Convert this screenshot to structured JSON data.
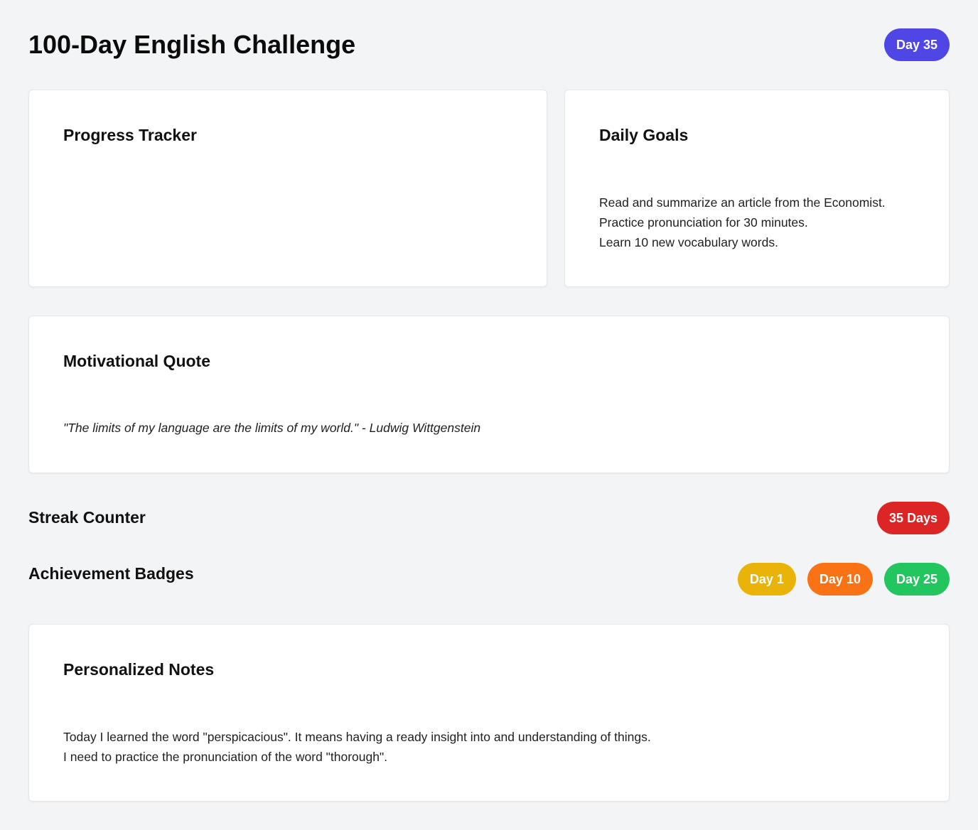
{
  "header": {
    "title": "100-Day English Challenge",
    "day_badge": "Day 35",
    "day_badge_color": "#4f46e5"
  },
  "progress": {
    "title": "Progress Tracker"
  },
  "goals": {
    "title": "Daily Goals",
    "items": [
      "Read and summarize an article from the Economist.",
      "Practice pronunciation for 30 minutes.",
      "Learn 10 new vocabulary words."
    ]
  },
  "quote": {
    "title": "Motivational Quote",
    "text": "\"The limits of my language are the limits of my world.\" - Ludwig Wittgenstein"
  },
  "streak": {
    "title": "Streak Counter",
    "value": "35 Days",
    "color": "#dc2626"
  },
  "badges": {
    "title": "Achievement Badges",
    "items": [
      {
        "label": "Day 1",
        "color": "#eab308"
      },
      {
        "label": "Day 10",
        "color": "#f97316"
      },
      {
        "label": "Day 25",
        "color": "#22c55e"
      }
    ]
  },
  "notes": {
    "title": "Personalized Notes",
    "lines": [
      "Today I learned the word \"perspicacious\". It means having a ready insight into and understanding of things.",
      "I need to practice the pronunciation of the word \"thorough\"."
    ]
  }
}
